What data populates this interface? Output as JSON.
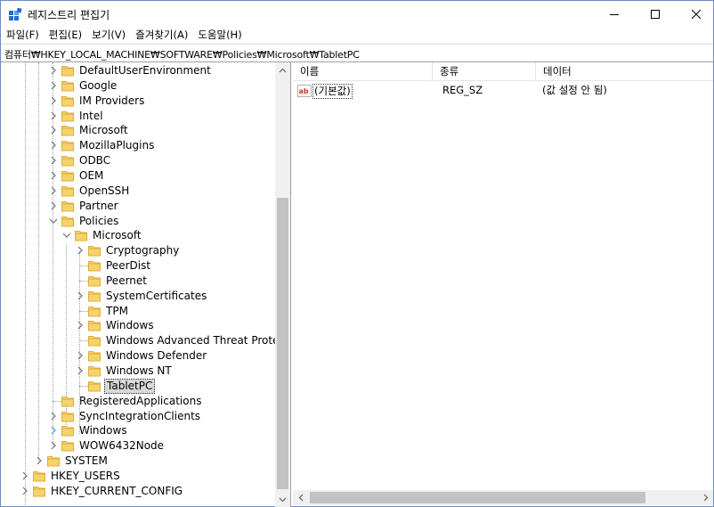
{
  "window": {
    "title": "레지스트리 편집기"
  },
  "menu": [
    {
      "label": "파일(F)"
    },
    {
      "label": "편집(E)"
    },
    {
      "label": "보기(V)"
    },
    {
      "label": "즐겨찾기(A)"
    },
    {
      "label": "도움말(H)"
    }
  ],
  "address": {
    "path": "컴퓨터₩HKEY_LOCAL_MACHINE₩SOFTWARE₩Policies₩Microsoft₩TabletPC"
  },
  "tree": {
    "nodes": [
      {
        "label": "DefaultUserEnvironment",
        "expanded": false
      },
      {
        "label": "Google",
        "expanded": false
      },
      {
        "label": "IM Providers",
        "expanded": false
      },
      {
        "label": "Intel",
        "expanded": false
      },
      {
        "label": "Microsoft",
        "expanded": false
      },
      {
        "label": "MozillaPlugins",
        "expanded": false
      },
      {
        "label": "ODBC",
        "expanded": false
      },
      {
        "label": "OEM",
        "expanded": false
      },
      {
        "label": "OpenSSH",
        "expanded": false
      },
      {
        "label": "Partner",
        "expanded": false
      },
      {
        "label": "Policies",
        "expanded": true
      },
      {
        "label": "Microsoft",
        "expanded": true
      },
      {
        "label": "Cryptography",
        "expanded": false
      },
      {
        "label": "PeerDist",
        "expanded": false
      },
      {
        "label": "Peernet",
        "expanded": false
      },
      {
        "label": "SystemCertificates",
        "expanded": false
      },
      {
        "label": "TPM",
        "expanded": false
      },
      {
        "label": "Windows",
        "expanded": false
      },
      {
        "label": "Windows Advanced Threat Protection",
        "expanded": false
      },
      {
        "label": "Windows Defender",
        "expanded": false
      },
      {
        "label": "Windows NT",
        "expanded": false
      },
      {
        "label": "TabletPC",
        "selected": true
      },
      {
        "label": "RegisteredApplications",
        "expanded": false
      },
      {
        "label": "SyncIntegrationClients",
        "expanded": false
      },
      {
        "label": "Windows",
        "expanded": false
      },
      {
        "label": "WOW6432Node",
        "expanded": false
      },
      {
        "label": "SYSTEM",
        "expanded": false
      },
      {
        "label": "HKEY_USERS",
        "expanded": false
      },
      {
        "label": "HKEY_CURRENT_CONFIG",
        "expanded": false
      }
    ]
  },
  "list": {
    "columns": {
      "name": "이름",
      "type": "종류",
      "data": "데이터"
    },
    "rows": [
      {
        "name": "(기본값)",
        "type": "REG_SZ",
        "data": "(값 설정 안 됨)",
        "icon": "reg-string-icon"
      }
    ]
  },
  "colors": {
    "folder": "#f6d26b",
    "folder_dark": "#dfae3c",
    "selection": "#d9d9d9",
    "scroll_thumb": "#c2c2c2",
    "scroll_track": "#f0f0f0"
  }
}
